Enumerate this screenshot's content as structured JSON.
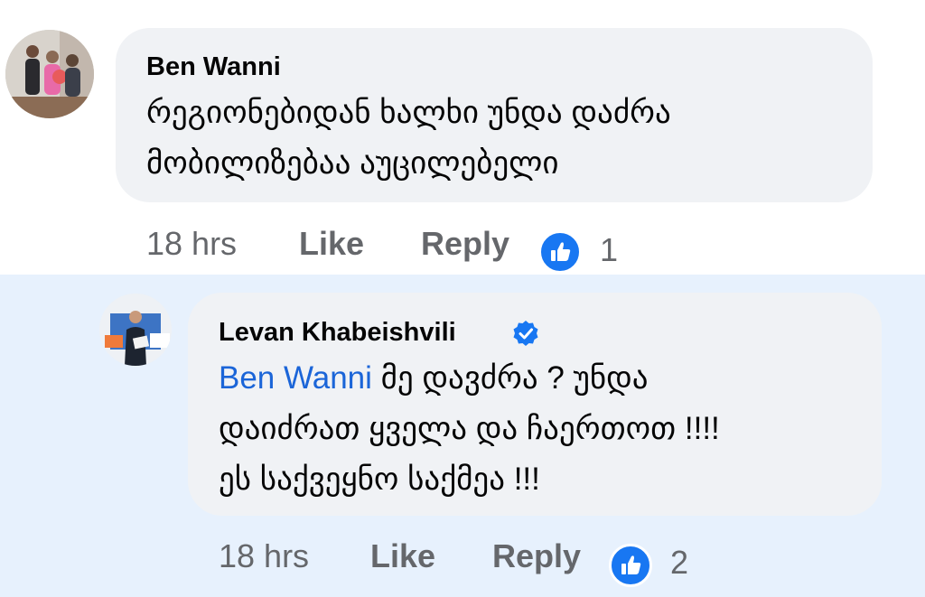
{
  "comments": [
    {
      "author": "Ben Wanni",
      "text_lines": [
        "რეგიონებიდან ხალხი უნდა დაძრა",
        "მობილიზებაა აუცილებელი"
      ],
      "time": "18 hrs",
      "like_label": "Like",
      "reply_label": "Reply",
      "reaction_count": "1"
    }
  ],
  "reply": {
    "author": "Levan Khabeishvili",
    "verified": true,
    "mention": "Ben Wanni",
    "text_first": " მე დავძრა ? უნდა",
    "text_lines": [
      "დაიძრათ ყველა და ჩაერთოთ !!!!",
      "ეს საქვეყნო საქმეა !!!"
    ],
    "time": "18 hrs",
    "like_label": "Like",
    "reply_label": "Reply",
    "reaction_count": "2"
  },
  "colors": {
    "accent": "#1877f2",
    "mention": "#1b65d8",
    "reply_background": "#e7f1fd",
    "bubble": "#f0f2f5"
  },
  "icons": [
    "thumbs-up-icon",
    "verified-badge-icon"
  ]
}
